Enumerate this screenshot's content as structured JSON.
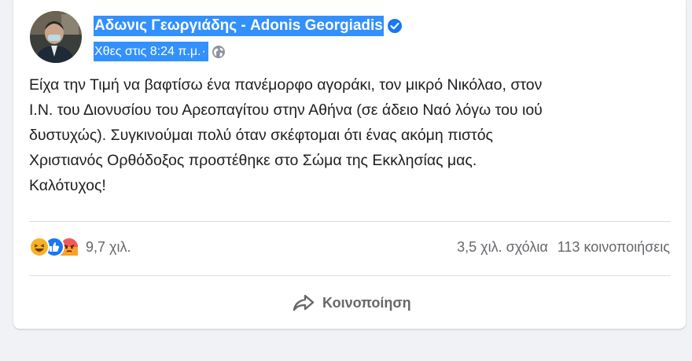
{
  "post": {
    "author_name": "Αδωνις Γεωργιάδης - Adonis Georgiadis",
    "timestamp": "Χθες στις 8:24 π.μ.",
    "meta_separator": "·",
    "text": "Είχα την Τιμή να βαφτίσω ένα πανέμορφο αγοράκι, τον μικρό Νικόλαο, στον\nΙ.Ν. του Διονυσίου του Αρεοπαγίτου στην Αθήνα (σε άδειο Ναό λόγω του ιού\nδυστυχώς). Συγκινούμαι πολύ όταν σκέφτομαι ότι ένας ακόμη πιστός\nΧριστιανός Ορθόδοξος προστέθηκε στο Σώμα της Εκκλησίας μας.\nΚαλότυχος!"
  },
  "reactions": {
    "icons": [
      "haha-reaction-icon",
      "like-reaction-icon",
      "angry-reaction-icon"
    ],
    "count": "9,7 χιλ."
  },
  "stats": {
    "comments": "3,5 χιλ. σχόλια",
    "shares": "113 κοινοποιήσεις"
  },
  "actions": {
    "share_label": "Κοινοποίηση"
  },
  "colors": {
    "selection_highlight": "#3390ff",
    "verified_badge": "#1877f2",
    "text_primary": "#1c1e21",
    "text_secondary": "#65676b",
    "page_background": "#f0f2f5"
  }
}
